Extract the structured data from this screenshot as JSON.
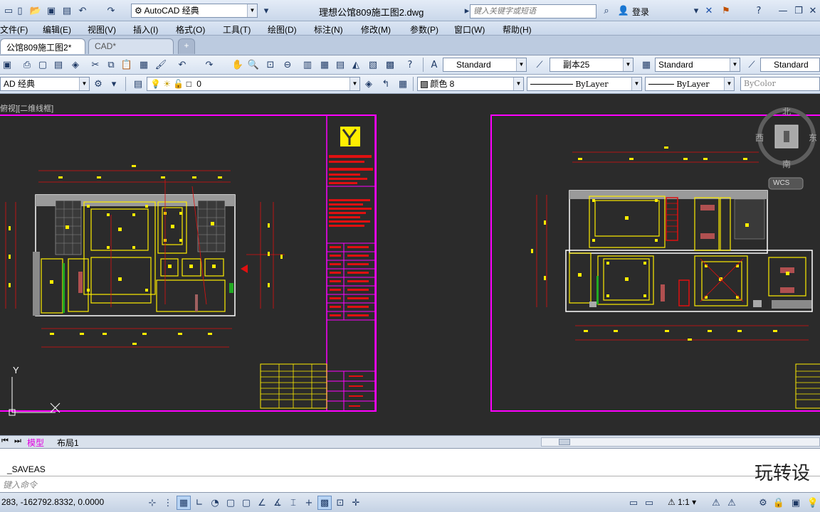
{
  "titlebar": {
    "workspace": "AutoCAD 经典",
    "doc_title": "理想公馆809施工图2.dwg",
    "search_placeholder": "键入关键字或短语",
    "login": "登录"
  },
  "menu": [
    "文件(F)",
    "编辑(E)",
    "视图(V)",
    "插入(I)",
    "格式(O)",
    "工具(T)",
    "绘图(D)",
    "标注(N)",
    "修改(M)",
    "参数(P)",
    "窗口(W)",
    "帮助(H)"
  ],
  "tabs": {
    "active": "公馆809施工图2*",
    "close": "×",
    "other": "CAD*"
  },
  "toolbar1": {
    "text_style": "Standard",
    "dim_style": "副本25",
    "table_style": "Standard",
    "multileader_style": "Standard"
  },
  "toolbar2": {
    "workspace": "AD 经典",
    "layer": "0",
    "color": "颜色 8",
    "linetype": "ByLayer",
    "lineweight": "ByLayer",
    "plotstyle": "ByColor"
  },
  "viewport": {
    "label": "俯视][二维线框]"
  },
  "viewcube": {
    "north": "北",
    "south": "南",
    "east": "东",
    "west": "西",
    "face": "上",
    "wcs": "WCS"
  },
  "ucs": {
    "y": "Y"
  },
  "layout_tabs": {
    "model": "模型",
    "layout1": "布局1"
  },
  "command": {
    "history": "_SAVEAS",
    "prompt": "键入命令"
  },
  "status": {
    "coords": "283, -162792.8332, 0.0000",
    "scale": "1:1"
  },
  "watermark": "玩转设",
  "colors": {
    "accent_magenta": "#ff00ff",
    "walls": "#ffffff",
    "dims": "#ff2020",
    "fixtures": "#ffff00"
  }
}
